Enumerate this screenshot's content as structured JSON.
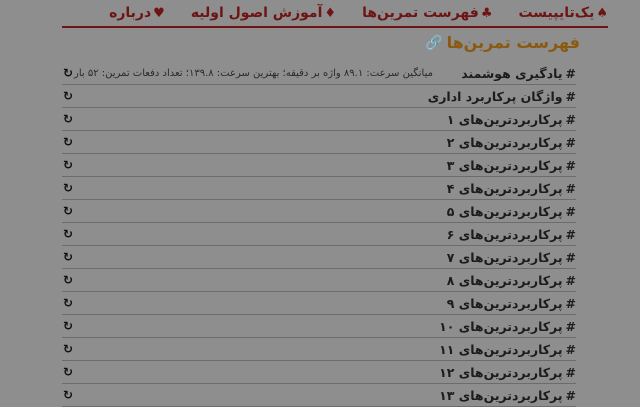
{
  "nav": [
    {
      "symbol": "♠",
      "label": "یک‌تایپیست"
    },
    {
      "symbol": "♣",
      "label": "فهرست تمرین‌ها"
    },
    {
      "symbol": "♦",
      "label": "آموزش اصول اولیه"
    },
    {
      "symbol": "♥",
      "label": "درباره"
    }
  ],
  "page": {
    "title": "فهرست تمرین‌ها",
    "title_icon": "link-icon"
  },
  "lessons": [
    {
      "label": "یادگیری هوشمند",
      "stats": "میانگین سرعت: ۸۹.۱ واژه بر دقیقه؛ بهترین سرعت: ۱۳۹.۸؛ تعداد دفعات تمرین: ۵۲ بار"
    },
    {
      "label": "واژگان پرکاربرد اداری"
    },
    {
      "label": "پرکاربردترین‌های ۱"
    },
    {
      "label": "پرکاربردترین‌های ۲"
    },
    {
      "label": "پرکاربردترین‌های ۳"
    },
    {
      "label": "پرکاربردترین‌های ۴"
    },
    {
      "label": "پرکاربردترین‌های ۵"
    },
    {
      "label": "پرکاربردترین‌های ۶"
    },
    {
      "label": "پرکاربردترین‌های ۷"
    },
    {
      "label": "پرکاربردترین‌های ۸"
    },
    {
      "label": "پرکاربردترین‌های ۹"
    },
    {
      "label": "پرکاربردترین‌های ۱۰"
    },
    {
      "label": "پرکاربردترین‌های ۱۱"
    },
    {
      "label": "پرکاربردترین‌های ۱۲"
    },
    {
      "label": "پرکاربردترین‌های ۱۳"
    }
  ],
  "icons": {
    "retry": "refresh-icon",
    "bullet": "#"
  },
  "colors": {
    "accent": "#6e1414",
    "heading": "#8a5a10",
    "background": "#8e8e8e"
  }
}
